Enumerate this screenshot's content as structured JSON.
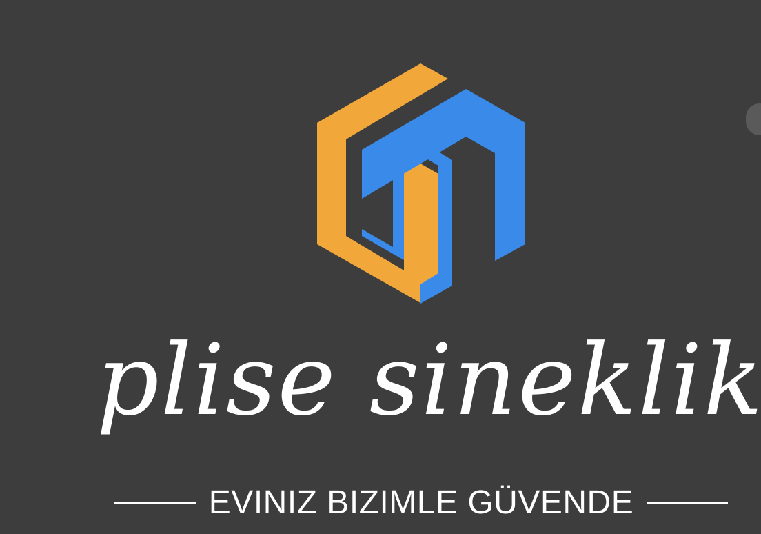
{
  "brand": {
    "wordmark": "plise sineklik",
    "tagline": "EVINIZ BIZIMLE GÜVENDE",
    "colors": {
      "background": "#3d3d3d",
      "orange": "#f2a73b",
      "blue": "#3a8be9",
      "text": "#ffffff"
    },
    "logo_icon": "hexagon-house-logo-icon"
  }
}
